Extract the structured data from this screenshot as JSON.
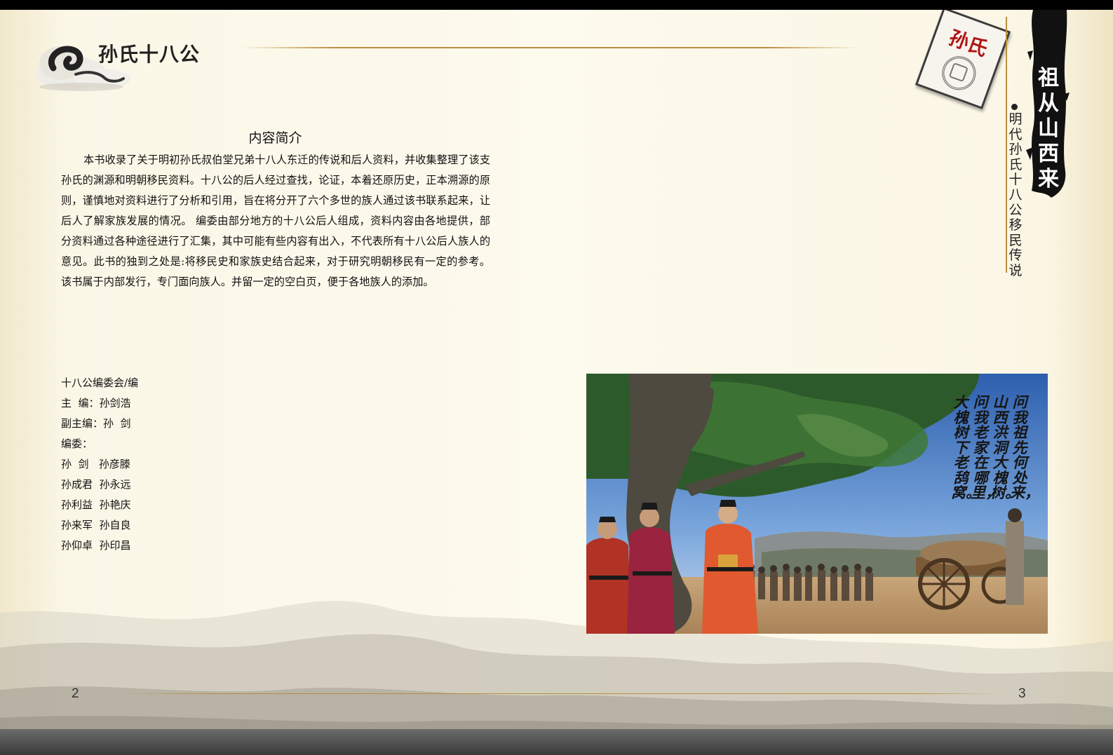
{
  "header": {
    "title": "孙氏十八公",
    "stamp_label": "孙氏",
    "brush_title": "祖从山西来",
    "vertical_subtitle": "明代孙氏十八公移民传说"
  },
  "content": {
    "heading": "内容简介",
    "intro": "本书收录了关于明初孙氏叔伯堂兄弟十八人东迁的传说和后人资料，并收集整理了该支孙氏的渊源和明朝移民资料。十八公的后人经过查找，论证，本着还原历史，正本溯源的原则，谨慎地对资料进行了分析和引用，旨在将分开了六个多世的族人通过该书联系起来，让后人了解家族发展的情况。 编委由部分地方的十八公后人组成，资料内容由各地提供，部分资料通过各种途径进行了汇集，其中可能有些内容有出入，不代表所有十八公后人族人的意见。此书的独到之处是:将移民史和家族史结合起来，对于研究明朝移民有一定的参考。该书属于内部发行，专门面向族人。并留一定的空白页，便于各地族人的添加。",
    "credits": [
      "十八公编委会/编",
      "主  编：孙剑浩",
      "副主编：孙  剑",
      "编委：",
      "孙  剑   孙彦滕",
      "孙成君  孙永远",
      "孙利益  孙艳庆",
      "孙来军  孙自良",
      "孙仰卓  孙印昌"
    ]
  },
  "photo": {
    "poem_columns": [
      "问我祖先何处来，",
      "山西洪洞大槐树。",
      "问我老家在哪里，",
      "大槐树下老鸹窝。"
    ]
  },
  "footer": {
    "page_left": "2",
    "page_right": "3"
  },
  "colors": {
    "accent_gold": "#b88f40",
    "stamp_red": "#b01515"
  }
}
